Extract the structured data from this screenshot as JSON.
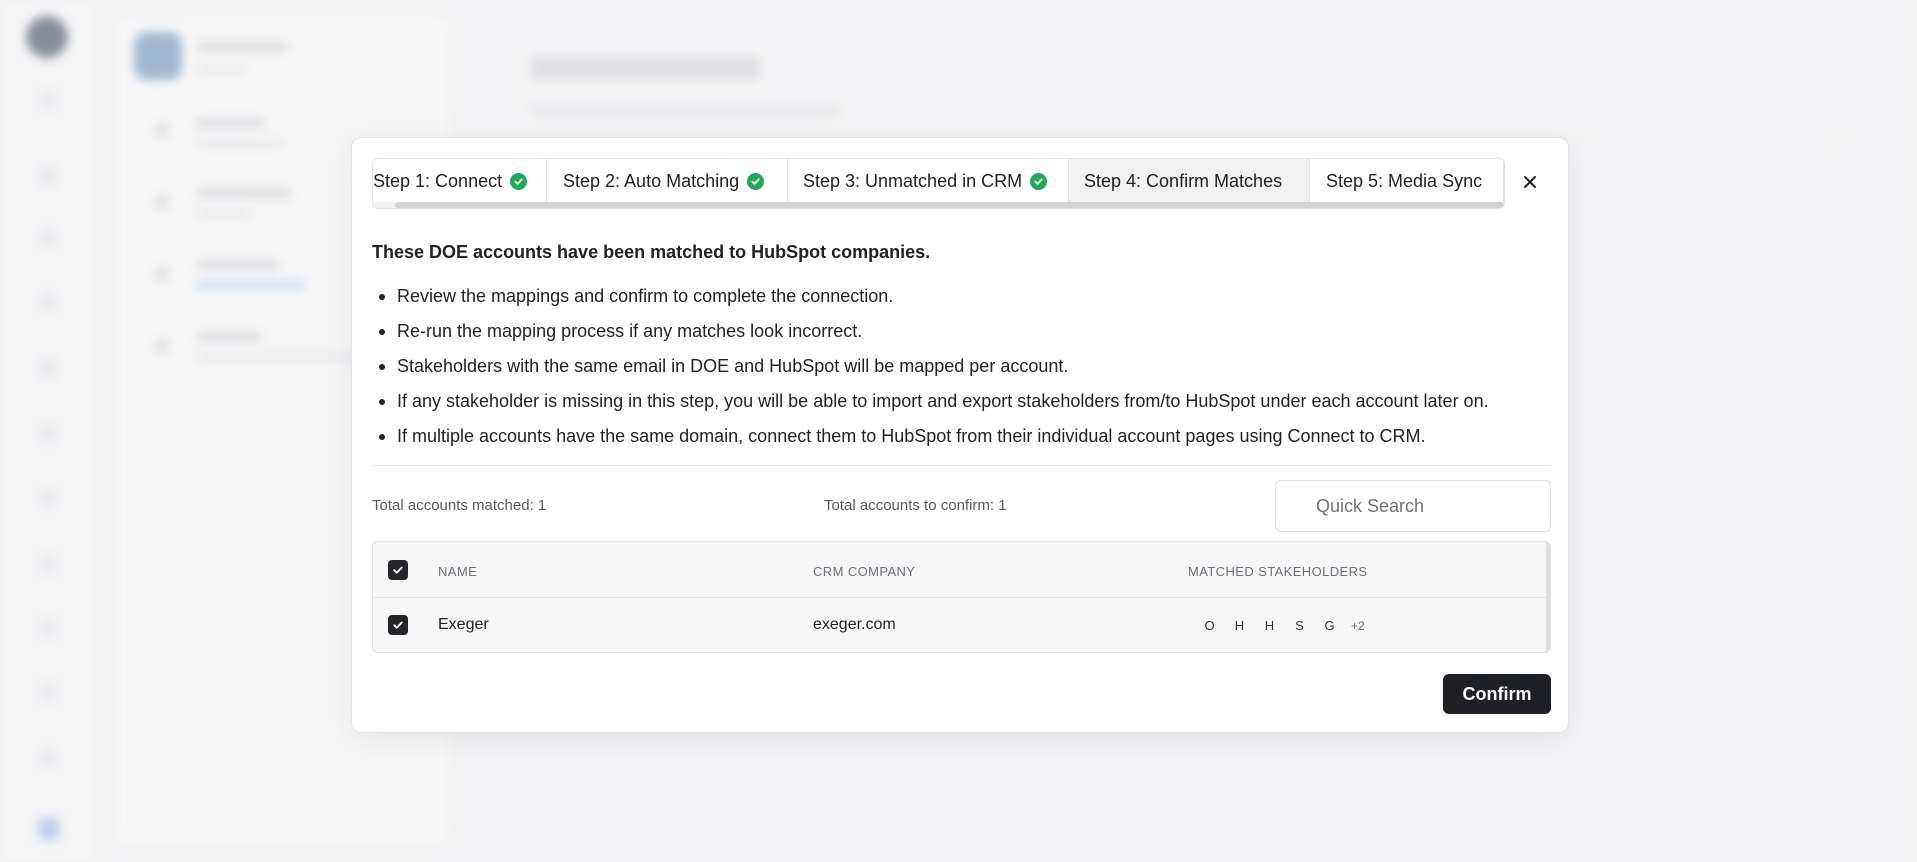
{
  "modal": {
    "tabs": [
      {
        "label": "Step 1: Connect",
        "completed": true
      },
      {
        "label": "Step 2: Auto Matching",
        "completed": true
      },
      {
        "label": "Step 3: Unmatched in CRM",
        "completed": true
      },
      {
        "label": "Step 4: Confirm Matches",
        "completed": false,
        "active": true
      },
      {
        "label": "Step 5: Media Sync",
        "completed": false
      }
    ],
    "intro": "These DOE accounts have been matched to HubSpot companies.",
    "bullets": [
      "Review the mappings and confirm to complete the connection.",
      "Re-run the mapping process if any matches look incorrect.",
      "Stakeholders with the same email in DOE and HubSpot will be mapped per account.",
      "If any stakeholder is missing in this step, you will be able to import and export stakeholders from/to HubSpot under each account later on.",
      "If multiple accounts have the same domain, connect them to HubSpot from their individual account pages using Connect to CRM."
    ],
    "total_matched": "Total accounts matched: 1",
    "total_to_confirm": "Total accounts to confirm: 1",
    "search_placeholder": "Quick Search",
    "table": {
      "headers": {
        "name": "NAME",
        "crm_company": "CRM COMPANY",
        "matched_stakeholders": "MATCHED STAKEHOLDERS"
      },
      "rows": [
        {
          "name": "Exeger",
          "crm_company": "exeger.com",
          "stakeholders": [
            "O",
            "H",
            "H",
            "S",
            "G"
          ],
          "more": "+2",
          "checked": true
        }
      ]
    },
    "confirm_label": "Confirm"
  },
  "colors": {
    "success": "#22a85a",
    "primary_button": "#1e2026",
    "active_tab": "#f1f1f2"
  }
}
